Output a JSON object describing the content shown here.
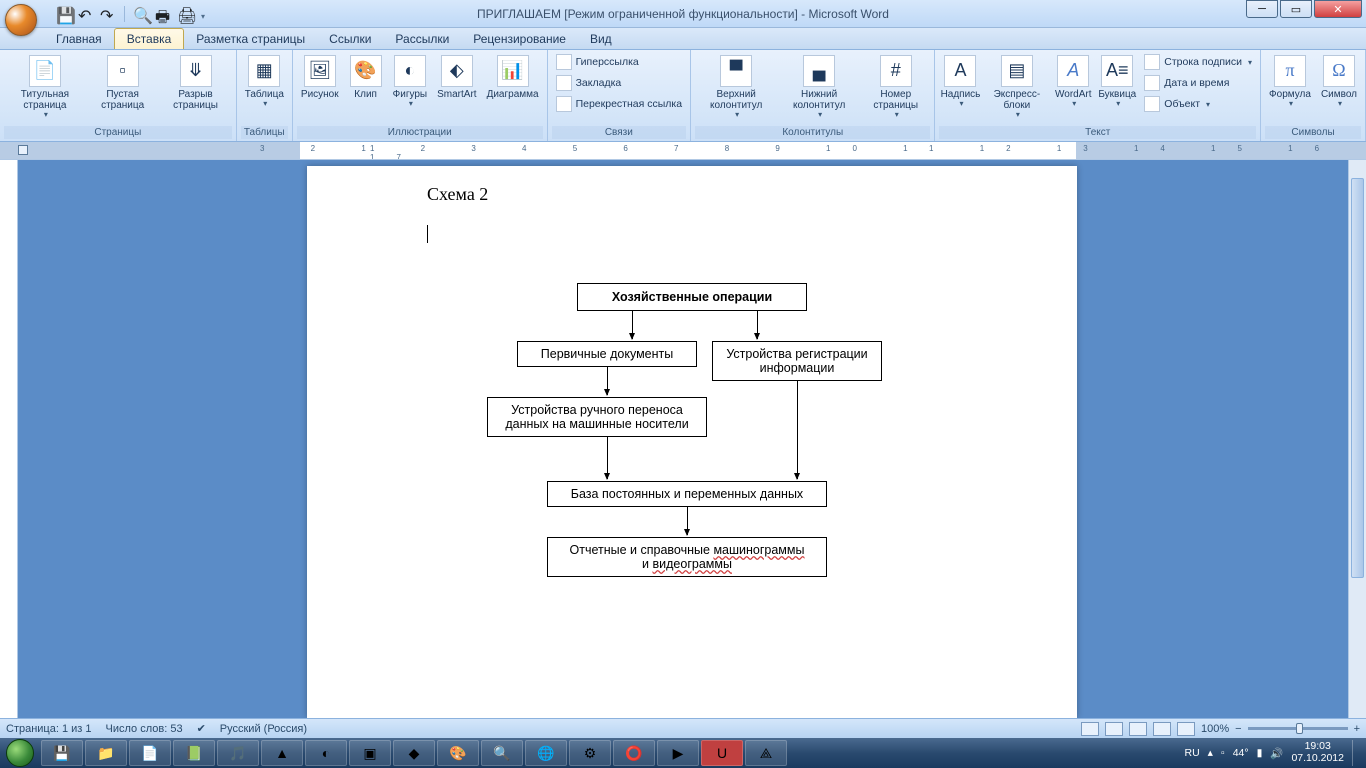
{
  "title": "ПРИГЛАШАЕМ [Режим ограниченной функциональности] - Microsoft Word",
  "tabs": [
    "Главная",
    "Вставка",
    "Разметка страницы",
    "Ссылки",
    "Рассылки",
    "Рецензирование",
    "Вид"
  ],
  "active_tab": 1,
  "ribbon": {
    "groups": [
      {
        "label": "Страницы",
        "items": [
          "Титульная страница",
          "Пустая страница",
          "Разрыв страницы"
        ]
      },
      {
        "label": "Таблицы",
        "items": [
          "Таблица"
        ]
      },
      {
        "label": "Иллюстрации",
        "items": [
          "Рисунок",
          "Клип",
          "Фигуры",
          "SmartArt",
          "Диаграмма"
        ]
      },
      {
        "label": "Связи",
        "items": [
          "Гиперссылка",
          "Закладка",
          "Перекрестная ссылка"
        ]
      },
      {
        "label": "Колонтитулы",
        "items": [
          "Верхний колонтитул",
          "Нижний колонтитул",
          "Номер страницы"
        ]
      },
      {
        "label": "Текст",
        "items": [
          "Надпись",
          "Экспресс-блоки",
          "WordArt",
          "Буквица"
        ],
        "extra": [
          "Строка подписи",
          "Дата и время",
          "Объект"
        ]
      },
      {
        "label": "Символы",
        "items": [
          "Формула",
          "Символ"
        ]
      }
    ]
  },
  "document": {
    "heading": "Схема 2",
    "boxes": {
      "b1": "Хозяйственные операции",
      "b2": "Первичные документы",
      "b3_l1": "Устройства регистрации",
      "b3_l2": "информации",
      "b4_l1": "Устройства ручного переноса",
      "b4_l2": "данных на машинные носители",
      "b5": "База постоянных и переменных данных",
      "b6_l1": "Отчетные и справочные ",
      "b6_w1": "машинограммы",
      "b6_l2": "и ",
      "b6_w2": "видеограммы"
    }
  },
  "status": {
    "page": "Страница: 1 из 1",
    "words": "Число слов: 53",
    "lang": "Русский (Россия)",
    "zoom": "100%"
  },
  "tray": {
    "lang": "RU",
    "temp": "44",
    "time": "19:03",
    "date": "07.10.2012"
  }
}
